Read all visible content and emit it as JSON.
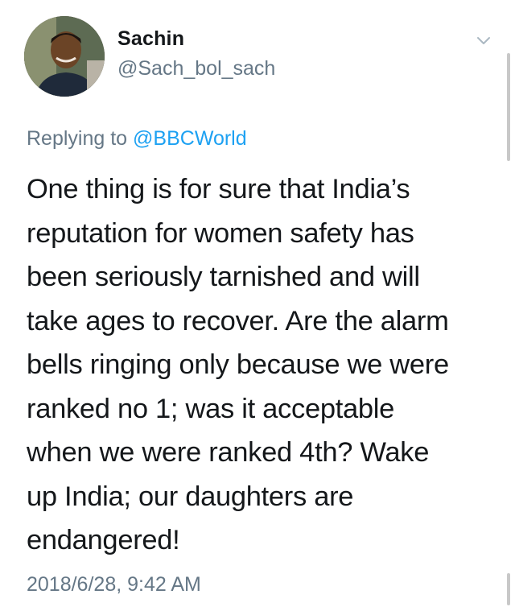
{
  "author": {
    "name": "Sachin",
    "handle": "@Sach_bol_sach"
  },
  "reply": {
    "prefix": "Replying to ",
    "mention": "@BBCWorld"
  },
  "tweet_text": "One thing is for sure that India’s\nreputation for women safety has\nbeen seriously tarnished and will\ntake ages to recover. Are the alarm\nbells ringing only because we were\nranked no 1; was it acceptable\nwhen we were ranked 4th? Wake\nup India; our daughters are\nendangered!",
  "timestamp": "2018/6/28, 9:42 AM",
  "icons": {
    "avatar": "profile-photo",
    "menu": "chevron-down-icon"
  },
  "colors": {
    "text": "#14171a",
    "secondary": "#657786",
    "accent": "#1da1f2"
  }
}
